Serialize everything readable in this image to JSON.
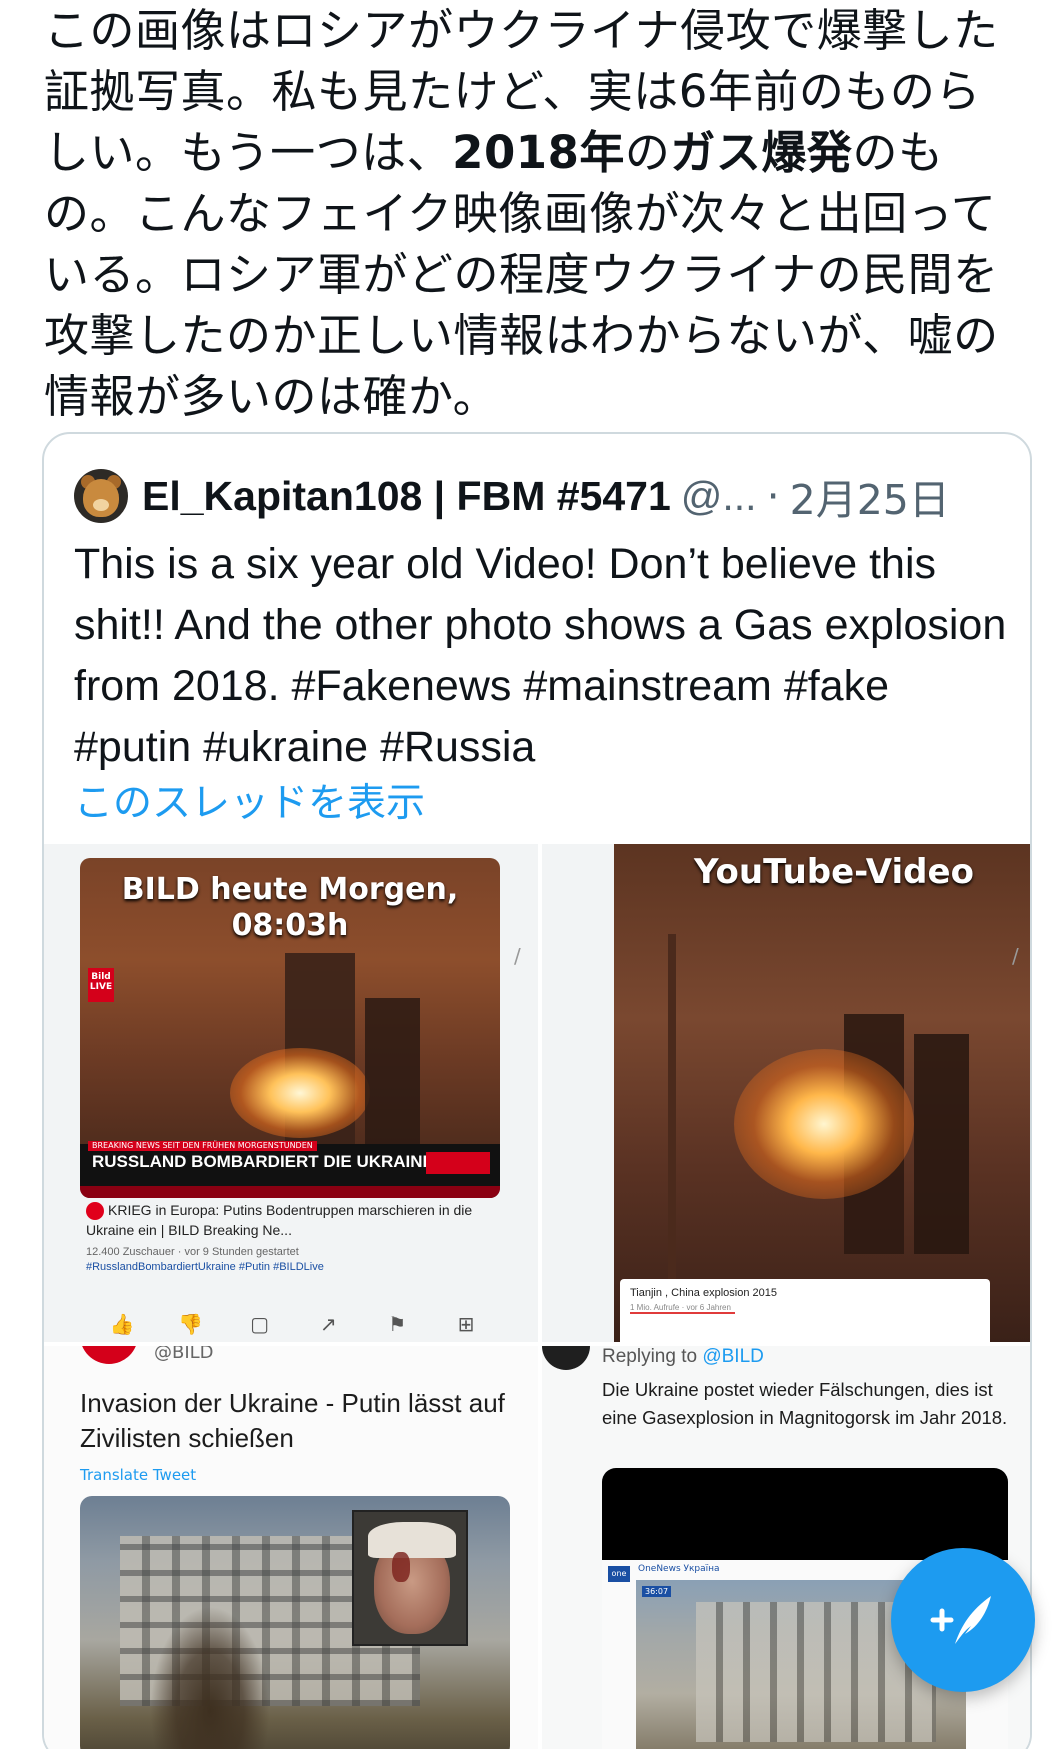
{
  "post": {
    "text_part1": "この画像はロシアがウクライナ侵攻で爆撃した証拠写真。私も見たけど、実は6年前のものらしい。もう一つは、",
    "text_bold1": "2018年",
    "text_part2": "の",
    "text_bold2": "ガス爆発",
    "text_part3": "のもの。こんなフェイク映像画像が次々と出回っている。ロシア軍がどの程度ウクライナの民間を攻撃したのか正しい情報はわからないが、嘘の情報が多いのは確か。"
  },
  "quoted_tweet": {
    "display_name": "El_Kapitan108 | FBM #5471",
    "handle": "@...",
    "separator": "·",
    "date": "2月25日",
    "body": "This is a six year old Video! Don’t believe this shit!! And the other photo shows a Gas explosion from 2018. #Fakenews #mainstream #fake #putin #ukraine #Russia",
    "show_thread": "このスレッドを表示"
  },
  "media": {
    "bild_video": {
      "overlay_title": "BILD heute Morgen, 08:03h",
      "logo": "Bild LIVE",
      "ticker_top": "BREAKING NEWS SEIT DEN FRÜHEN MORGENSTUNDEN",
      "ticker_headline": "RUSSLAND BOMBARDIERT DIE UKRAINE",
      "meta_title": "KRIEG in Europa: Putins Bodentruppen marschieren in die Ukraine ein | BILD Breaking Ne...",
      "meta_stats": "12.400 Zuschauer · vor 9 Stunden gestartet",
      "meta_tags": "#RusslandBombardiertUkraine #Putin #BILDLive",
      "actions": [
        "like",
        "dislike",
        "save",
        "share",
        "report",
        "clip"
      ]
    },
    "youtube_video": {
      "overlay_title": "YouTube-Video",
      "caption_title": "Tianjin , China explosion 2015",
      "caption_meta": "1 Mio. Aufrufe · vor 6 Jahren"
    },
    "bild_tweet": {
      "handle": "@BILD",
      "text": "Invasion der Ukraine - Putin lässt auf Zivilisten schießen",
      "translate": "Translate Tweet"
    },
    "reply_tweet": {
      "replying_prefix": "Replying to",
      "replying_handle": "@BILD",
      "text": "Die Ukraine postet wieder Fälschungen, dies ist eine Gasexplosion in Magnitogorsk im Jahr 2018.",
      "news_logo": "one",
      "news_name": "OneNews Україна",
      "news_time": "36:07"
    }
  },
  "fab": {
    "icon": "compose-tweet-icon"
  },
  "colors": {
    "accent": "#1d9bf0",
    "text": "#0f1419",
    "muted": "#536471",
    "border": "#cfd9de"
  }
}
